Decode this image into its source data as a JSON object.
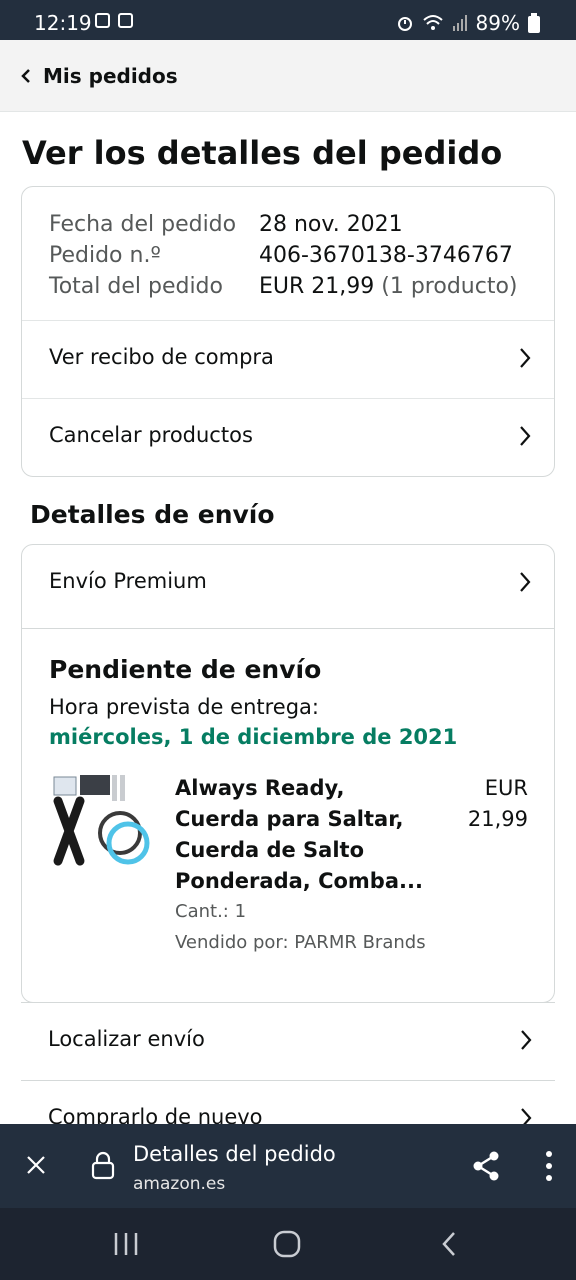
{
  "status_bar": {
    "time": "12:19",
    "battery": "89%"
  },
  "header": {
    "back_label": "Mis pedidos"
  },
  "page": {
    "title": "Ver los detalles del pedido"
  },
  "order_summary": {
    "rows": [
      {
        "label": "Fecha del pedido",
        "value": "28 nov. 2021",
        "extra": ""
      },
      {
        "label": "Pedido n.º",
        "value": "406-3670138-3746767",
        "extra": ""
      },
      {
        "label": "Total del pedido",
        "value": "EUR 21,99",
        "extra": "(1 producto)"
      }
    ],
    "links": [
      "Ver recibo de compra",
      "Cancelar productos"
    ]
  },
  "shipping": {
    "section_title": "Detalles de envío",
    "method_label": "Envío Premium",
    "status": "Pendiente de envío",
    "eta_label": "Hora prevista de entrega:",
    "eta_date": "miércoles, 1 de diciembre de 2021",
    "product": {
      "title": "Always Ready, Cuerda para Saltar, Cuerda de Salto Ponderada, Comba...",
      "price_currency": "EUR",
      "price_value": "21,99",
      "qty": "Cant.: 1",
      "seller": "Vendido por: PARMR Brands"
    }
  },
  "actions": [
    "Localizar envío",
    "Comprarlo de nuevo"
  ],
  "browser": {
    "title": "Detalles del pedido",
    "domain": "amazon.es"
  },
  "colors": {
    "dark_bar": "#232f3e",
    "delivery_green": "#067d62"
  },
  "icons": [
    "back-chevron-icon",
    "chevron-right-icon",
    "close-icon",
    "lock-icon",
    "share-icon",
    "more-icon",
    "recents-icon",
    "home-icon",
    "back-icon"
  ]
}
